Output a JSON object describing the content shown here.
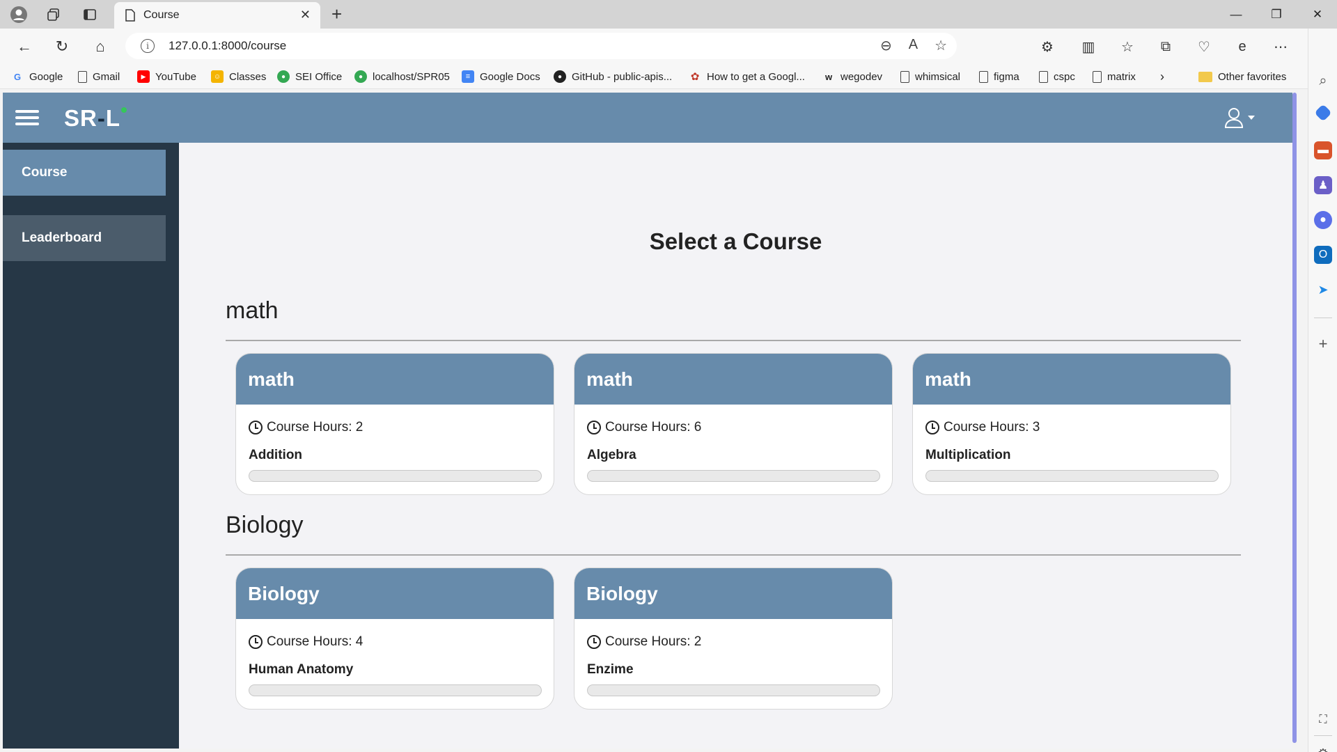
{
  "browser": {
    "tab_title": "Course",
    "url": "127.0.0.1:8000/course",
    "bookmarks": [
      {
        "label": "Google",
        "icon": "google-icon",
        "color": "#4285f4"
      },
      {
        "label": "Gmail",
        "icon": "page-icon",
        "color": "#444444"
      },
      {
        "label": "YouTube",
        "icon": "youtube-icon",
        "color": "#ff0000"
      },
      {
        "label": "Classes",
        "icon": "classroom-icon",
        "color": "#f4b400"
      },
      {
        "label": "SEI Office",
        "icon": "sei-icon",
        "color": "#34a853"
      },
      {
        "label": "localhost/SPR05",
        "icon": "localhost-icon",
        "color": "#34a853"
      },
      {
        "label": "Google Docs",
        "icon": "docs-icon",
        "color": "#4285f4"
      },
      {
        "label": "GitHub - public-apis...",
        "icon": "github-icon",
        "color": "#222222"
      },
      {
        "label": "How to get a Googl...",
        "icon": "octopus-icon",
        "color": "#c0392b"
      },
      {
        "label": "wegodev",
        "icon": "w-icon",
        "color": "#222222"
      },
      {
        "label": "whimsical",
        "icon": "page-icon",
        "color": "#444444"
      },
      {
        "label": "figma",
        "icon": "page-icon",
        "color": "#444444"
      },
      {
        "label": "cspc",
        "icon": "page-icon",
        "color": "#444444"
      },
      {
        "label": "matrix",
        "icon": "page-icon",
        "color": "#444444"
      }
    ],
    "other_favorites": "Other favorites"
  },
  "app": {
    "logo_left": "SR",
    "logo_dash": "-",
    "logo_right": "L",
    "brand_color": "#678bab",
    "sidebar": {
      "items": [
        {
          "label": "Course",
          "active": true
        },
        {
          "label": "Leaderboard",
          "active": false
        }
      ]
    },
    "page_title": "Select a Course",
    "hours_label": "Course Hours:",
    "sections": [
      {
        "title": "math",
        "courses": [
          {
            "category": "math",
            "hours": 2,
            "name": "Addition",
            "progress": 0
          },
          {
            "category": "math",
            "hours": 6,
            "name": "Algebra",
            "progress": 0
          },
          {
            "category": "math",
            "hours": 3,
            "name": "Multiplication",
            "progress": 0
          }
        ]
      },
      {
        "title": "Biology",
        "courses": [
          {
            "category": "Biology",
            "hours": 4,
            "name": "Human Anatomy",
            "progress": 0
          },
          {
            "category": "Biology",
            "hours": 2,
            "name": "Enzime",
            "progress": 0
          }
        ]
      }
    ]
  }
}
